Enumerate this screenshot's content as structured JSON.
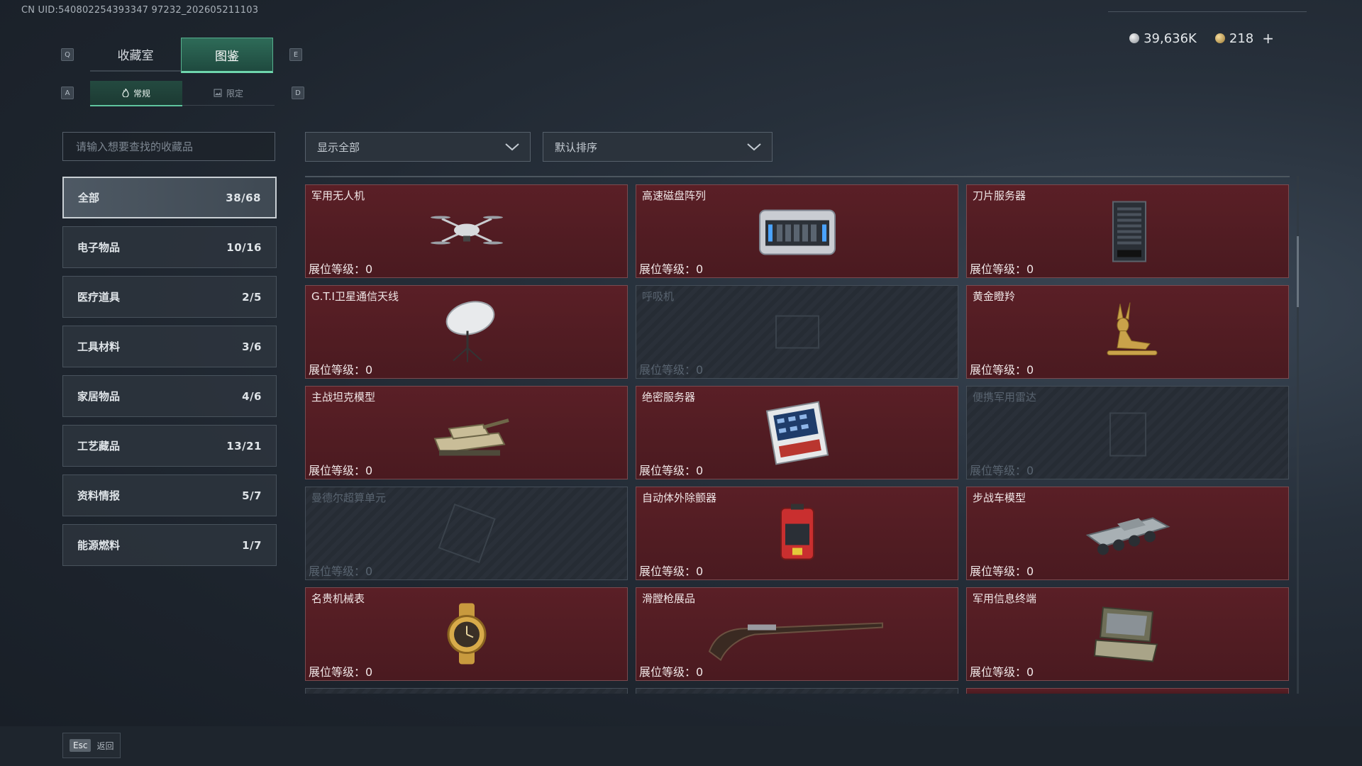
{
  "uid": "CN UID:540802254393347 97232_202605211103",
  "currency": {
    "silver": "39,636K",
    "gold": "218",
    "plus": "+"
  },
  "keys": {
    "q": "Q",
    "e": "E",
    "a": "A",
    "d": "D"
  },
  "tabs": [
    {
      "label": "收藏室"
    },
    {
      "label": "图鉴"
    }
  ],
  "subtabs": [
    {
      "label": "常规"
    },
    {
      "label": "限定"
    }
  ],
  "search": {
    "placeholder": "请输入想要查找的收藏品"
  },
  "filters": {
    "show": "显示全部",
    "sort": "默认排序"
  },
  "categories": [
    {
      "label": "全部",
      "count": "38/68"
    },
    {
      "label": "电子物品",
      "count": "10/16"
    },
    {
      "label": "医疗道具",
      "count": "2/5"
    },
    {
      "label": "工具材料",
      "count": "3/6"
    },
    {
      "label": "家居物品",
      "count": "4/6"
    },
    {
      "label": "工艺藏品",
      "count": "13/21"
    },
    {
      "label": "资料情报",
      "count": "5/7"
    },
    {
      "label": "能源燃料",
      "count": "1/7"
    }
  ],
  "level_label": "展位等级：",
  "items": [
    {
      "name": "军用无人机",
      "level": "0",
      "icon": "drone-icon"
    },
    {
      "name": "高速磁盘阵列",
      "level": "0",
      "icon": "disk-array-icon"
    },
    {
      "name": "刀片服务器",
      "level": "0",
      "icon": "blade-server-icon"
    },
    {
      "name": "G.T.I卫星通信天线",
      "level": "0",
      "icon": "satellite-dish-icon"
    },
    {
      "name": "呼吸机",
      "level": "0",
      "icon": "ventilator-icon",
      "locked": true
    },
    {
      "name": "黄金瞪羚",
      "level": "0",
      "icon": "golden-gazelle-icon"
    },
    {
      "name": "主战坦克模型",
      "level": "0",
      "icon": "tank-model-icon"
    },
    {
      "name": "绝密服务器",
      "level": "0",
      "icon": "secret-server-icon"
    },
    {
      "name": "便携军用雷达",
      "level": "0",
      "icon": "radar-icon",
      "locked": true
    },
    {
      "name": "曼德尔超算单元",
      "level": "0",
      "icon": "supercomputer-icon",
      "locked": true
    },
    {
      "name": "自动体外除颤器",
      "level": "0",
      "icon": "defibrillator-icon"
    },
    {
      "name": "步战车模型",
      "level": "0",
      "icon": "ifv-model-icon"
    },
    {
      "name": "名贵机械表",
      "level": "0",
      "icon": "watch-icon"
    },
    {
      "name": "滑膛枪展品",
      "level": "0",
      "icon": "musket-icon"
    },
    {
      "name": "军用信息终端",
      "level": "0",
      "icon": "terminal-icon"
    }
  ],
  "back": {
    "key": "Esc",
    "label": "返回"
  },
  "colors": {
    "accent": "#5fc49e",
    "owned_card": "#5a1f26",
    "locked_card": "#2a3039"
  }
}
